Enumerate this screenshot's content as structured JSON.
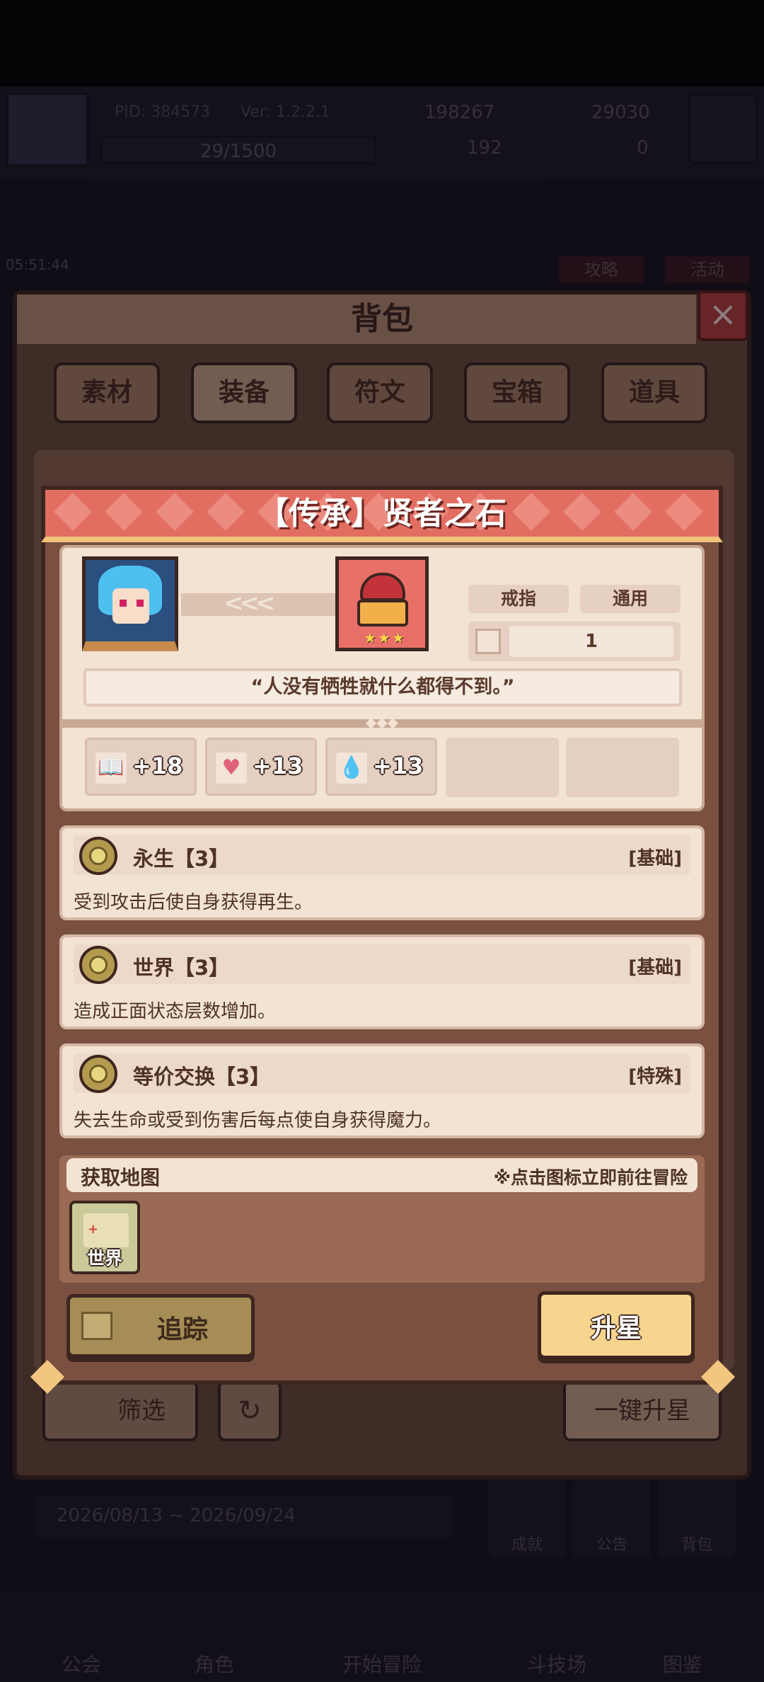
{
  "background": {
    "pid": "PID: 384573",
    "version": "Ver: 1.2.2.1",
    "gold": "198267",
    "gems": "29030",
    "exp": "29/1500",
    "clover": "192",
    "keys": "0",
    "timer": "05:51:44",
    "strategy_label": "攻略",
    "event_label": "活动",
    "date_range": "2026/08/13 ~ 2026/09/24",
    "mini_buttons": [
      "成就",
      "公告",
      "背包"
    ],
    "nav": [
      "公会",
      "角色",
      "开始冒险",
      "斗技场",
      "图鉴"
    ]
  },
  "bag": {
    "title": "背包",
    "tabs": [
      "素材",
      "装备",
      "符文",
      "宝箱",
      "道具"
    ],
    "active_tab": 1,
    "filter_label": "筛选",
    "refresh_icon": "↻",
    "star_all_label": "一键升星"
  },
  "item": {
    "title": "【传承】贤者之石",
    "slot_tag": "戒指",
    "usage_tag": "通用",
    "count": "1",
    "stars": "★★★",
    "quote": "“人没有牺牲就什么都得不到。”",
    "stats": [
      {
        "icon": "book-icon",
        "glyph": "📖",
        "value": "+18"
      },
      {
        "icon": "heart-icon",
        "glyph": "♥",
        "value": "+13"
      },
      {
        "icon": "drop-icon",
        "glyph": "💧",
        "value": "+13"
      }
    ],
    "skills": [
      {
        "name": "永生【3】",
        "type": "[基础]",
        "desc": "受到攻击后使自身获得再生。"
      },
      {
        "name": "世界【3】",
        "type": "[基础]",
        "desc": "造成正面状态层数增加。"
      },
      {
        "name": "等价交换【3】",
        "type": "[特殊]",
        "desc": "失去生命或受到伤害后每点使自身获得魔力。"
      }
    ],
    "map_title": "获取地图",
    "map_hint": "※点击图标立即前往冒险",
    "map_name": "世界",
    "track_label": "追踪",
    "upgrade_label": "升星"
  },
  "colors": {
    "title_red": "#e26e61",
    "panel_cream": "#f3e3d3",
    "border_dark": "#3d261f",
    "button_gold": "#f8d58e"
  }
}
